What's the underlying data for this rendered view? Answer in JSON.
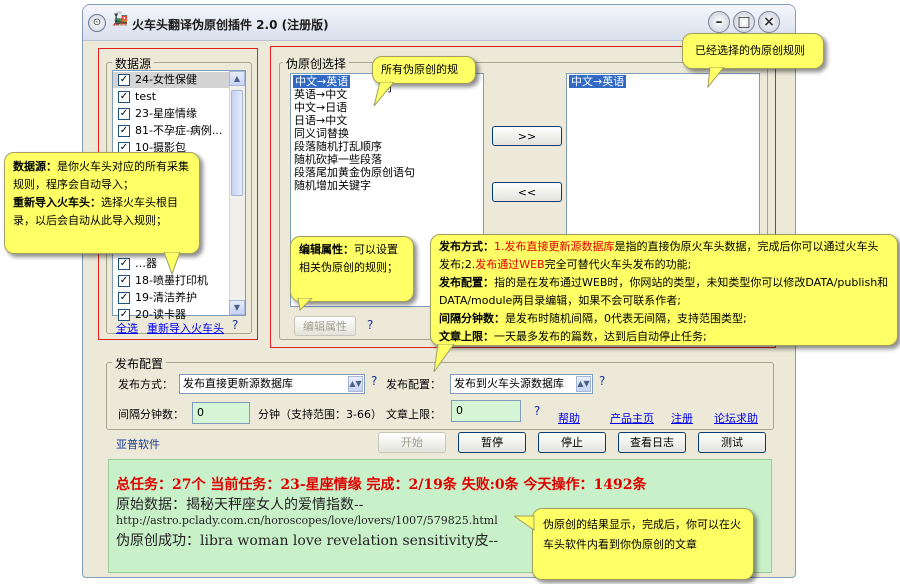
{
  "window": {
    "title": "火车头翻译伪原创插件 2.0 (注册版)",
    "icon": "train-icon",
    "controls": {
      "minimize": "–",
      "maximize": "□",
      "close": "×"
    }
  },
  "datasource": {
    "label": "数据源",
    "items": [
      {
        "label": "24-女性保健",
        "checked": true,
        "selected": true
      },
      {
        "label": "test",
        "checked": true
      },
      {
        "label": "23-星座情缘",
        "checked": true
      },
      {
        "label": "81-不孕症-病例...",
        "checked": true
      },
      {
        "label": "10-摄影包",
        "checked": true
      }
    ],
    "bottom_items": [
      {
        "label": "…器",
        "checked": true
      },
      {
        "label": "18-喷墨打印机",
        "checked": true
      },
      {
        "label": "19-清洁养护",
        "checked": true
      },
      {
        "label": "20-读卡器",
        "checked": true
      }
    ],
    "select_all": "全选",
    "reimport": "重新导入火车头",
    "help": "?"
  },
  "pseudo": {
    "label": "伪原创选择",
    "rules": [
      "中文→英语",
      "英语→中文",
      "中文→日语",
      "日语→中文",
      "同义词替换",
      "段落随机打乱顺序",
      "随机砍掉一些段落",
      "段落尾加黄金伪原创语句",
      "随机增加关键字"
    ],
    "selected_rules": [
      "中文→英语"
    ],
    "add_button": ">>",
    "remove_button": "<<",
    "edit_button": "编辑属性",
    "help": "?"
  },
  "publish": {
    "label": "发布配置",
    "method_label": "发布方式：",
    "method_value": "发布直接更新源数据库",
    "config_label": "发布配置：",
    "config_value": "发布到火车头源数据库",
    "interval_label": "间隔分钟数：",
    "interval_value": "0",
    "interval_unit": "分钟（支持范围：3-66）",
    "limit_label": "文章上限：",
    "limit_value": "0",
    "help": "?",
    "links": {
      "help": "帮助",
      "home": "产品主页",
      "register": "注册",
      "forum": "论坛求助"
    }
  },
  "company": "亚普软件",
  "actions": {
    "start": "开始",
    "pause": "暂停",
    "stop": "停止",
    "log": "查看日志",
    "test": "测试"
  },
  "status": {
    "summary": "总任务：27个  当前任务：23-星座情缘  完成：2/19条  失败:0条  今天操作：1492条",
    "raw": "原始数据：揭秘天秤座女人的爱情指数--",
    "url": "http://astro.pclady.com.cn/horoscopes/love/lovers/1007/579825.html",
    "result": "伪原创成功：libra woman love revelation sensitivity皮--"
  },
  "callouts": {
    "all_rules": "所有伪原创的规则",
    "selected_rules": "已经选择的伪原创规则",
    "datasource": {
      "term1": "数据源：",
      "text1": "是你火车头对应的所有采集规则，程序会自动导入；",
      "term2": "重新导入火车头：",
      "text2": "选择火车头根目录，以后会自动从此导入规则；"
    },
    "edit": {
      "term": "编辑属性：",
      "text": "可以设置相关伪原创的规则；"
    },
    "publish": {
      "method_term": "发布方式：",
      "m1_num": "1.",
      "m1_red": "发布直接更新源数据库",
      "m1_rest": "是指的直接伪原火车头数据，完成后你可以通过火车头发布;",
      "m2_num": "2.",
      "m2_red": "发布通过WEB",
      "m2_rest": "完全可替代火车头发布的功能;",
      "config_term": "发布配置：",
      "config_text": "指的是在发布通过WEB时，你网站的类型，未知类型你可以修改DATA/publish和DATA/module两目录编辑，如果不会可联系作者;",
      "interval_term": "间隔分钟数：",
      "interval_text": "是发布时随机间隔，0代表无间隔，支持范围类型;",
      "limit_term": "文章上限：",
      "limit_text": "一天最多发布的篇数，达到后自动停止任务;"
    },
    "result": "伪原创的结果显示，完成后，你可以在火车头软件内看到你伪原创的文章"
  }
}
